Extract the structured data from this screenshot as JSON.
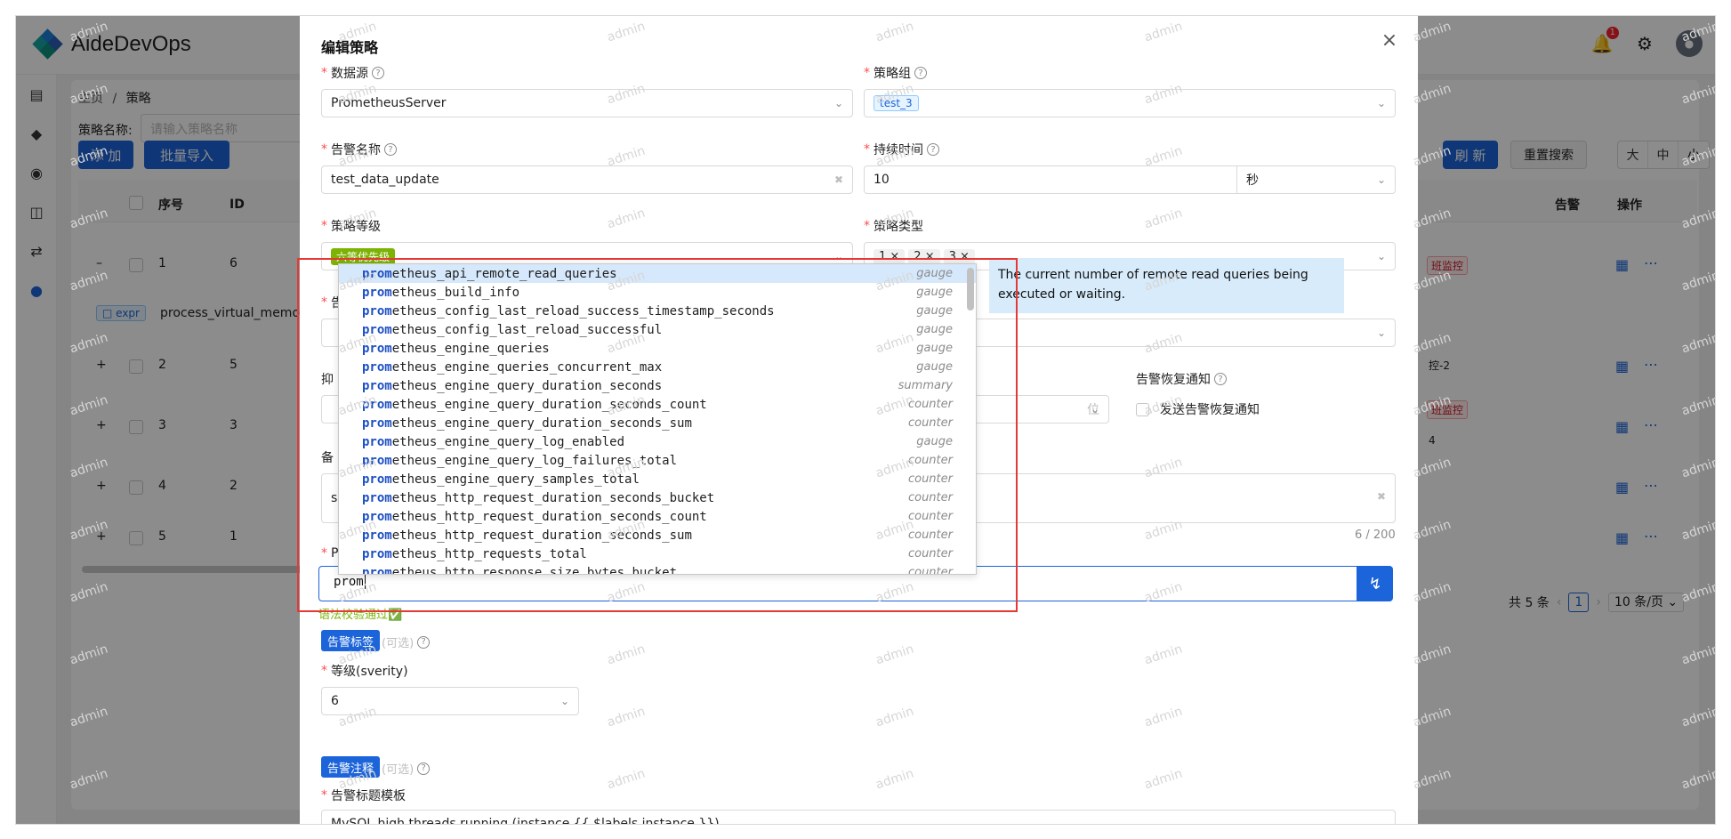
{
  "app": {
    "title": "AideDevOps",
    "notification_count": "1"
  },
  "breadcrumb": {
    "home": "主页",
    "sep": "/",
    "current": "策略"
  },
  "query": {
    "label": "策略名称:",
    "placeholder": "请输入策略名称"
  },
  "toolbar": {
    "add": "添 加",
    "import": "批量导入",
    "refresh": "刷 新",
    "reset": "重置搜索",
    "size_large": "大",
    "size_mid": "中",
    "size_small": "小"
  },
  "table": {
    "headers": {
      "seq": "序号",
      "id": "ID",
      "alert": "告警",
      "ops": "操作"
    },
    "rows": [
      {
        "expand": "–",
        "seq": "1",
        "id": "6",
        "tag": "班监控"
      },
      {
        "expand": "+",
        "seq": "2",
        "id": "5",
        "tag": "控-2"
      },
      {
        "expand": "+",
        "seq": "3",
        "id": "3",
        "tag": "班监控"
      },
      {
        "expand": "+",
        "seq": "4",
        "id": "2",
        "tag": ""
      },
      {
        "expand": "+",
        "seq": "5",
        "id": "1",
        "tag": ""
      }
    ],
    "expr_tag": "expr",
    "expr_text": "process_virtual_memory",
    "row3_extra": "4"
  },
  "pagination": {
    "total": "共 5 条",
    "current": "1",
    "page_size": "10 条/页"
  },
  "watermark": "admin",
  "modal": {
    "title": "编辑策略",
    "close": "×",
    "datasource": {
      "label": "数据源",
      "value": "PrometheusServer"
    },
    "group": {
      "label": "策略组",
      "value": "test_3"
    },
    "alert_name": {
      "label": "告警名称",
      "value": "test_data_update"
    },
    "duration": {
      "label": "持续时间",
      "value": "10",
      "unit": "秒"
    },
    "level": {
      "label": "策略等级",
      "value": "六等优先级"
    },
    "type": {
      "label": "策略类型",
      "values": [
        "1 ×",
        "2 ×",
        "3 ×"
      ]
    },
    "recover": {
      "label": "告警恢复通知",
      "checkbox": "发送告警恢复通知"
    },
    "partial_labels": {
      "inhibit": "抑",
      "remark": "备",
      "remark_value": "s",
      "promql": "P",
      "alert_label_cut": "告",
      "unit_cut": "位"
    },
    "remark_counter": "6 / 200",
    "promql_input": "prom",
    "syntax_ok": "语法校验通过✅",
    "labels_section": {
      "badge": "告警标签",
      "optional": "(可选)"
    },
    "severity": {
      "label": "等级(sverity)",
      "value": "6"
    },
    "annotations_section": {
      "badge": "告警注释",
      "optional": "(可选)"
    },
    "title_template": {
      "label": "告警标题模板",
      "value": "MySQL high threads running (instance {{ $labels.instance }})"
    }
  },
  "autocomplete": {
    "match": "prom",
    "items": [
      {
        "rest": "etheus_api_remote_read_queries",
        "type": "gauge"
      },
      {
        "rest": "etheus_build_info",
        "type": "gauge"
      },
      {
        "rest": "etheus_config_last_reload_success_timestamp_seconds",
        "type": "gauge"
      },
      {
        "rest": "etheus_config_last_reload_successful",
        "type": "gauge"
      },
      {
        "rest": "etheus_engine_queries",
        "type": "gauge"
      },
      {
        "rest": "etheus_engine_queries_concurrent_max",
        "type": "gauge"
      },
      {
        "rest": "etheus_engine_query_duration_seconds",
        "type": "summary"
      },
      {
        "rest": "etheus_engine_query_duration_seconds_count",
        "type": "counter"
      },
      {
        "rest": "etheus_engine_query_duration_seconds_sum",
        "type": "counter"
      },
      {
        "rest": "etheus_engine_query_log_enabled",
        "type": "gauge"
      },
      {
        "rest": "etheus_engine_query_log_failures_total",
        "type": "counter"
      },
      {
        "rest": "etheus_engine_query_samples_total",
        "type": "counter"
      },
      {
        "rest": "etheus_http_request_duration_seconds_bucket",
        "type": "counter"
      },
      {
        "rest": "etheus_http_request_duration_seconds_count",
        "type": "counter"
      },
      {
        "rest": "etheus_http_request_duration_seconds_sum",
        "type": "counter"
      },
      {
        "rest": "etheus_http_requests_total",
        "type": "counter"
      },
      {
        "rest": "etheus_http_response_size_bytes_bucket",
        "type": "counter"
      }
    ],
    "doc": "The current number of remote read queries being executed or waiting."
  }
}
